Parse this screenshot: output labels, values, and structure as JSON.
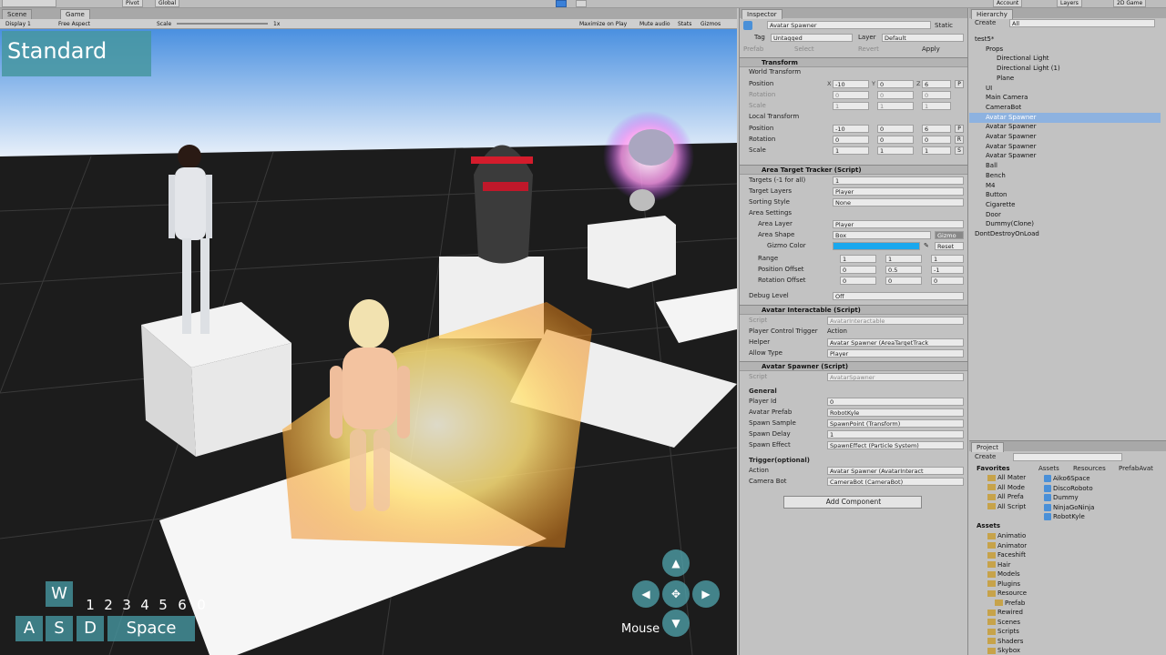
{
  "toolbar": {
    "pivot": "Pivot",
    "global": "Global",
    "account": "Account",
    "layers": "Layers",
    "layout": "2D Game"
  },
  "game_panel": {
    "tabs": [
      "Scene",
      "Game"
    ],
    "display": "Display 1",
    "aspect": "Free Aspect",
    "scale_label": "Scale",
    "scale_value": "1x",
    "buttons": [
      "Maximize on Play",
      "Mute audio",
      "Stats",
      "Gizmos"
    ],
    "overlay": {
      "mode": "Standard",
      "keys": {
        "w": "W",
        "a": "A",
        "s": "S",
        "d": "D",
        "space": "Space"
      },
      "numbers": [
        "1",
        "2",
        "3",
        "4",
        "5",
        "6",
        "0"
      ],
      "mouse": "Mouse"
    }
  },
  "inspector": {
    "tab": "Inspector",
    "object_name": "Avatar Spawner",
    "static": "Static",
    "tag_label": "Tag",
    "tag": "Untagged",
    "layer_label": "Layer",
    "layer": "Default",
    "prefab_label": "Prefab",
    "prefab_select": "Select",
    "prefab_revert": "Revert",
    "prefab_apply": "Apply",
    "transform": {
      "title": "Transform",
      "world": "World Transform",
      "local": "Local Transform",
      "position": "Position",
      "rotation": "Rotation",
      "scale": "Scale",
      "world_pos": [
        "-10",
        "0",
        "6"
      ],
      "world_rot": [
        "0",
        "0",
        "0"
      ],
      "world_scale": [
        "1",
        "1",
        "1"
      ],
      "local_pos": [
        "-10",
        "0",
        "6"
      ],
      "local_rot": [
        "0",
        "0",
        "0"
      ],
      "local_scale": [
        "1",
        "1",
        "1"
      ],
      "p": "P",
      "r": "R",
      "s": "S",
      "x": "X",
      "y": "Y",
      "z": "Z"
    },
    "area": {
      "title": "Area Target Tracker (Script)",
      "targets_label": "Targets (-1 for all)",
      "targets": "1",
      "target_layers_label": "Target Layers",
      "target_layers": "Player",
      "sorting_label": "Sorting Style",
      "sorting": "None",
      "settings": "Area Settings",
      "area_layer_label": "Area Layer",
      "area_layer": "Player",
      "area_shape_label": "Area Shape",
      "area_shape": "Box",
      "gizmo_btn": "Gizmo",
      "gizmo_color_label": "Gizmo Color",
      "gizmo_color": "#1aa8ee",
      "reset": "Reset",
      "range_label": "Range",
      "range": [
        "1",
        "1",
        "1"
      ],
      "pos_off_label": "Position Offset",
      "pos_off": [
        "0",
        "0.5",
        "-1"
      ],
      "rot_off_label": "Rotation Offset",
      "rot_off": [
        "0",
        "0",
        "0"
      ],
      "debug_label": "Debug Level",
      "debug": "Off"
    },
    "interactable": {
      "title": "Avatar Interactable (Script)",
      "script_label": "Script",
      "script": "AvatarInteractable",
      "trigger_label": "Player Control Trigger",
      "trigger": "Action",
      "helper_label": "Helper",
      "helper": "Avatar Spawner (AreaTargetTrack",
      "allow_label": "Allow Type",
      "allow": "Player"
    },
    "spawner": {
      "title": "Avatar Spawner (Script)",
      "script_label": "Script",
      "script": "AvatarSpawner",
      "general": "General",
      "player_id_label": "Player Id",
      "player_id": "0",
      "prefab_label": "Avatar Prefab",
      "prefab": "RobotKyle",
      "sample_label": "Spawn Sample",
      "sample": "SpawnPoint (Transform)",
      "delay_label": "Spawn Delay",
      "delay": "1",
      "effect_label": "Spawn Effect",
      "effect": "SpawnEffect (Particle System)",
      "trigger_opt": "Trigger(optional)",
      "action_label": "Action",
      "action": "Avatar Spawner (AvatarInteract",
      "camera_label": "Camera Bot",
      "camera": "CameraBot (CameraBot)"
    },
    "add_component": "Add Component"
  },
  "hierarchy": {
    "tab": "Hierarchy",
    "create": "Create",
    "search": "All",
    "items": [
      {
        "label": "test5*",
        "indent": 0
      },
      {
        "label": "Props",
        "indent": 1
      },
      {
        "label": "Directional Light",
        "indent": 2
      },
      {
        "label": "Directional Light (1)",
        "indent": 2
      },
      {
        "label": "Plane",
        "indent": 2
      },
      {
        "label": "UI",
        "indent": 1
      },
      {
        "label": "Main Camera",
        "indent": 1
      },
      {
        "label": "CameraBot",
        "indent": 1
      },
      {
        "label": "Avatar Spawner",
        "indent": 1,
        "selected": true
      },
      {
        "label": "Avatar Spawner",
        "indent": 1
      },
      {
        "label": "Avatar Spawner",
        "indent": 1
      },
      {
        "label": "Avatar Spawner",
        "indent": 1
      },
      {
        "label": "Avatar Spawner",
        "indent": 1
      },
      {
        "label": "Ball",
        "indent": 1
      },
      {
        "label": "Bench",
        "indent": 1
      },
      {
        "label": "M4",
        "indent": 1
      },
      {
        "label": "Button",
        "indent": 1
      },
      {
        "label": "Cigarette",
        "indent": 1
      },
      {
        "label": "Door",
        "indent": 1
      },
      {
        "label": "Dummy(Clone)",
        "indent": 1
      },
      {
        "label": "DontDestroyOnLoad",
        "indent": 0
      }
    ]
  },
  "project": {
    "tab": "Project",
    "create": "Create",
    "favorites_label": "Favorites",
    "favorites": [
      "All Mater",
      "All Mode",
      "All Prefa",
      "All Script"
    ],
    "assets_label": "Assets",
    "folders": [
      "Animatio",
      "Animator",
      "Faceshift",
      "Hair",
      "Models",
      "Plugins",
      "Resource",
      "Prefab",
      "Rewired",
      "Scenes",
      "Scripts",
      "Shaders",
      "Skybox"
    ],
    "breadcrumb": [
      "Assets",
      "Resources",
      "PrefabAvat"
    ],
    "files": [
      "Aiko6Space",
      "DiscoRoboto",
      "Dummy",
      "NinjaGoNinja",
      "RobotKyle"
    ]
  }
}
